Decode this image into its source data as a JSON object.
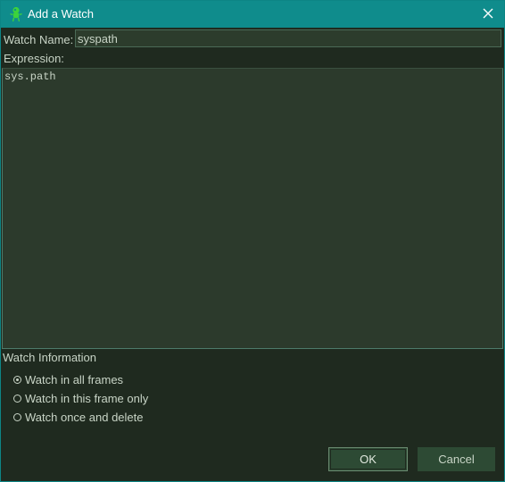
{
  "window": {
    "title": "Add a Watch",
    "close_glyph": "✕"
  },
  "form": {
    "watch_name_label": "Watch Name:",
    "watch_name_value": "syspath",
    "expression_label": "Expression:",
    "expression_value": "sys.path"
  },
  "watch_info": {
    "label": "Watch Information",
    "options": [
      {
        "label": "Watch in all frames",
        "checked": true
      },
      {
        "label": "Watch in this frame only",
        "checked": false
      },
      {
        "label": "Watch once and delete",
        "checked": false
      }
    ]
  },
  "buttons": {
    "ok_label": "OK",
    "cancel_label": "Cancel"
  },
  "colors": {
    "titlebar": "#0f8c8c",
    "background": "#1f2a1f",
    "field_background": "#2c3a2c",
    "button_background": "#2d4a34",
    "app_icon": "#3cd23c"
  },
  "icons": {
    "app": "wingware-bug-icon",
    "close": "close-icon"
  }
}
